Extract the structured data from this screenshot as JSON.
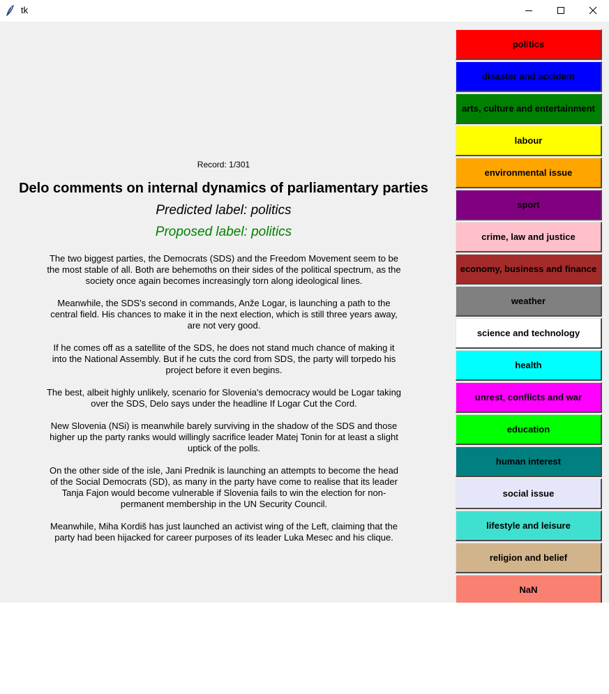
{
  "window": {
    "title": "tk"
  },
  "record": {
    "text": "Record: 1/301"
  },
  "article": {
    "headline": "Delo comments on internal dynamics of parliamentary parties",
    "predicted": "Predicted label: politics",
    "proposed": "Proposed label: politics",
    "proposed_color": "#008000",
    "paragraphs": [
      "The two biggest parties, the Democrats (SDS) and the Freedom Movement seem to be the most stable of all. Both are behemoths on their sides of the political spectrum, as the society once again becomes increasingly torn along ideological lines.",
      "Meanwhile, the SDS's second in commands, Anže Logar, is launching a path to the central field. His chances to make it in the next election, which is still three years away, are not very good.",
      "If he comes off as a satellite of the SDS, he does not stand much chance of making it into the National Assembly. But if he cuts the cord from SDS, the party will torpedo his project before it even begins.",
      "The best, albeit highly unlikely, scenario for Slovenia's democracy would be Logar taking over the SDS, Delo says under the headline If Logar Cut the Cord.",
      "New Slovenia (NSi) is meanwhile barely surviving in the shadow of the SDS and those higher up the party ranks would willingly sacrifice leader Matej Tonin for at least a slight uptick of the polls.",
      "On the other side of the isle, Jani Prednik is launching an attempts to become the head of the Social Democrats (SD), as many in the party have come to realise that its leader Tanja Fajon would become vulnerable if Slovenia fails to win the election for non-permanent membership in the UN Security Council.",
      "Meanwhile, Miha Kordiš has just launched an activist wing of the Left, claiming that the party had been hijacked for career purposes of its leader Luka Mesec and his clique."
    ]
  },
  "labels": [
    {
      "text": "politics",
      "color": "#ff0000"
    },
    {
      "text": "disaster and accident",
      "color": "#0000ff"
    },
    {
      "text": "arts, culture and entertainment",
      "color": "#008000"
    },
    {
      "text": "labour",
      "color": "#ffff00"
    },
    {
      "text": "environmental issue",
      "color": "#ffa500"
    },
    {
      "text": "sport",
      "color": "#800080"
    },
    {
      "text": "crime, law and justice",
      "color": "#ffc0cb"
    },
    {
      "text": "economy, business and finance",
      "color": "#a52a2a"
    },
    {
      "text": "weather",
      "color": "#808080"
    },
    {
      "text": "science and technology",
      "color": "#ffffff"
    },
    {
      "text": "health",
      "color": "#00ffff"
    },
    {
      "text": "unrest, conflicts and war",
      "color": "#ff00ff"
    },
    {
      "text": "education",
      "color": "#00ff00"
    },
    {
      "text": "human interest",
      "color": "#008080"
    },
    {
      "text": "social issue",
      "color": "#e6e6fa"
    },
    {
      "text": "lifestyle and leisure",
      "color": "#40e0d0"
    },
    {
      "text": "religion and belief",
      "color": "#d2b48c"
    },
    {
      "text": "NaN",
      "color": "#fa8072"
    }
  ]
}
